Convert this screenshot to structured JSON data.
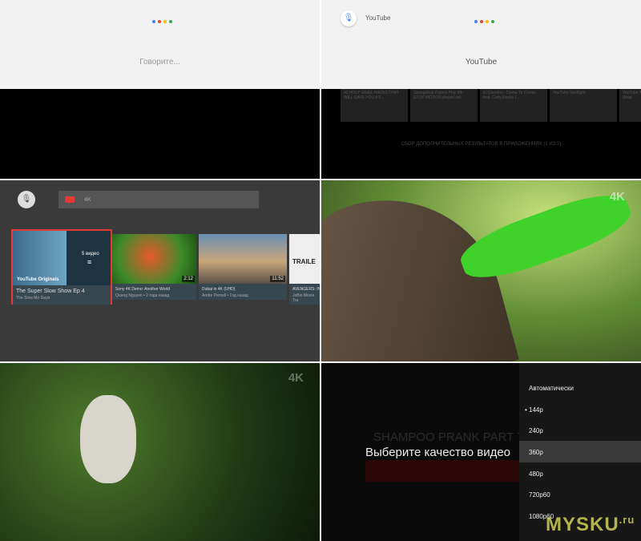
{
  "panel1": {
    "prompt": "Говорите..."
  },
  "panel2": {
    "query": "YouTube",
    "result_title": "YouTube",
    "cards": [
      "42 HOLY GRAIL HACKS THAT WILL SAVE YOU A F...",
      "Spongebob Patrick Play 8th STOP MOTION played vid...",
      "El Chombo - Dame Tu Cosita feat. Cutty Ranks (...",
      "YouTube Spotlight",
      "YouTube The Shap"
    ],
    "status": "СБОР ДОПОЛНИТЕЛЬНЫХ РЕЗУЛЬТАТОВ В ПРИЛОЖЕНИЯХ (1 ИЗ 2)"
  },
  "panel3": {
    "search": "4K",
    "videos": [
      {
        "title": "The Super Slow Show  Ep 4",
        "sub": "The Slow Mo Guys",
        "badge": "YouTube Originals",
        "count": "5 видео"
      },
      {
        "title": "Sony 4K Demo: Another World",
        "sub": "Quang Nguyen • 2 года назад",
        "duration": "2:12"
      },
      {
        "title": "Dubai in 4K (UHD)",
        "sub": "Andre Pernell • Год назад",
        "duration": "11:52"
      },
      {
        "title": "AVENGERS: IN",
        "sub": "JoBlo Movie Tra",
        "badge": "TRAILE"
      }
    ]
  },
  "panel4": {
    "watermark": "4K"
  },
  "panel5": {
    "watermark": "4K"
  },
  "panel6": {
    "video_title": "SHAMPOO PRANK PART 7!",
    "dialog_title": "Выберите качество видео",
    "options": [
      "Автоматически",
      "144p",
      "240p",
      "360p",
      "480p",
      "720p60",
      "1080p60"
    ],
    "current": "144p",
    "focused": "360p"
  },
  "watermark": {
    "brand": "MYSKU",
    ".ru": ".ru"
  },
  "colors": {
    "accent": "#e53935",
    "google": [
      "#4285f4",
      "#ea4335",
      "#fbbc05",
      "#34a853"
    ]
  }
}
